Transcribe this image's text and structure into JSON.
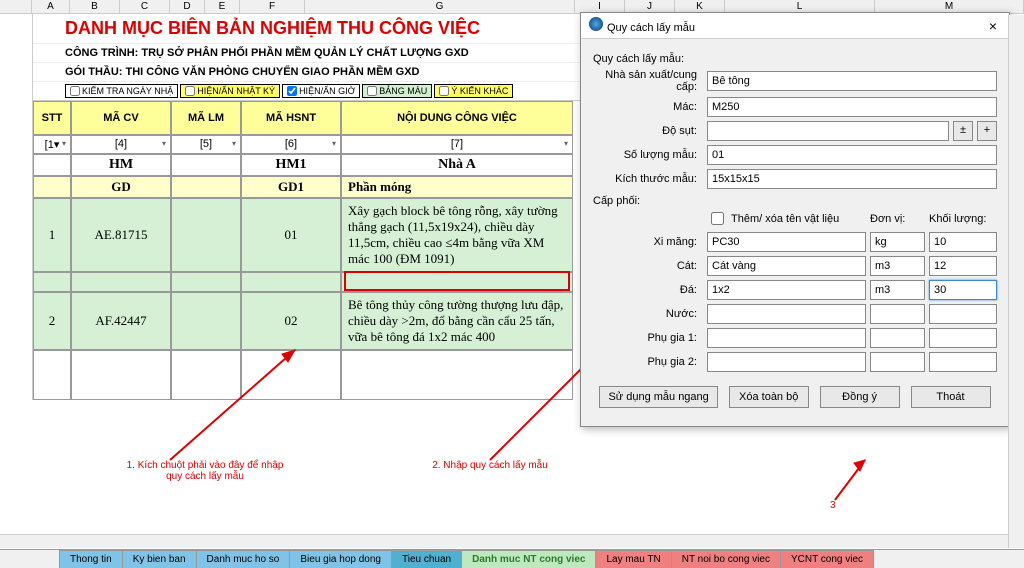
{
  "columns": [
    "A",
    "B",
    "C",
    "D",
    "E",
    "F",
    "G",
    "I",
    "J",
    "K",
    "L",
    "M"
  ],
  "title": "DANH MỤC BIÊN BẢN NGHIỆM THU CÔNG VIỆC",
  "subtitle1_label": "CÔNG TRÌNH:",
  "subtitle1_value": "TRỤ SỞ PHÂN PHỐI PHẦN MỀM QUẢN LÝ CHẤT LƯỢNG GXD",
  "subtitle2_label": "GÓI THẦU:",
  "subtitle2_value": "THI CÔNG VĂN PHÒNG CHUYỂN GIAO PHẦN MỀM GXD",
  "checks": {
    "c1": "KIỂM TRA NGÀY NHẬ",
    "c2": "HIỆN/ẨN NHẬT KÝ",
    "c3": "HIỆN/ẨN GIỜ",
    "c4": "BẢNG MÀU",
    "c5": "Ý KIẾN KHÁC"
  },
  "headers": {
    "stt": "STT",
    "macv": "MÃ CV",
    "malm": "MÃ LM",
    "mahsnt": "MÃ HSNT",
    "noidung": "NỘI DUNG CÔNG VIỆC"
  },
  "filters": [
    "[1▾",
    "[4]",
    "[5]",
    "[6]",
    "[7]"
  ],
  "row_hm": {
    "b": "HM",
    "d": "HM1",
    "e": "Nhà A"
  },
  "row_gd": {
    "b": "GD",
    "d": "GD1",
    "e": "Phần móng"
  },
  "rows": [
    {
      "stt": "1",
      "macv": "AE.81715",
      "mahsnt": "01",
      "nd": "Xây gạch block bê tông rỗng, xây tường thẳng gạch (11,5x19x24), chiều dày 11,5cm, chiều cao ≤4m bằng vữa XM mác 100 (ĐM 1091)"
    },
    {
      "stt": "2",
      "macv": "AF.42447",
      "mahsnt": "02",
      "nd": "Bê tông thủy công tường thượng lưu đập, chiều dày >2m, đổ bằng cần cẩu 25 tấn, vữa bê tông đá 1x2 mác 400"
    }
  ],
  "notes": {
    "n1": "1. Kích chuột phải vào đây để nhập quy cách lấy mẫu",
    "n2": "2. Nhập quy cách lấy mẫu",
    "n3": "3"
  },
  "tabs": [
    "Thong tin",
    "Ky bien ban",
    "Danh muc ho so",
    "Bieu gia hop dong",
    "Tieu chuan",
    "Danh muc NT cong viec",
    "Lay mau TN",
    "NT noi bo cong viec",
    "YCNT cong viec"
  ],
  "dialog": {
    "title": "Quy cách lấy mẫu",
    "section1": "Quy cách lấy mẫu:",
    "fields": {
      "nsx": {
        "label": "Nhà sản xuất/cung cấp:",
        "value": "Bê tông"
      },
      "mac": {
        "label": "Mác:",
        "value": "M250"
      },
      "dosut": {
        "label": "Độ sụt:",
        "value": ""
      },
      "soluong": {
        "label": "Số lượng mẫu:",
        "value": "01"
      },
      "kichthuoc": {
        "label": "Kích thước mẫu:",
        "value": "15x15x15"
      }
    },
    "pm_btn": "±",
    "plus_btn": "+",
    "section2": "Cấp phối:",
    "chk_themxoa": "Thêm/ xóa tên vật liệu",
    "col_donvi": "Đơn vị:",
    "col_khoiluong": "Khối lượng:",
    "mix": [
      {
        "label": "Xi măng:",
        "name": "PC30",
        "unit": "kg",
        "qty": "10"
      },
      {
        "label": "Cát:",
        "name": "Cát vàng",
        "unit": "m3",
        "qty": "12"
      },
      {
        "label": "Đá:",
        "name": "1x2",
        "unit": "m3",
        "qty": "30"
      },
      {
        "label": "Nước:",
        "name": "",
        "unit": "",
        "qty": ""
      },
      {
        "label": "Phụ gia 1:",
        "name": "",
        "unit": "",
        "qty": ""
      },
      {
        "label": "Phụ gia 2:",
        "name": "",
        "unit": "",
        "qty": ""
      }
    ],
    "buttons": {
      "b1": "Sử dụng mẫu ngang",
      "b2": "Xóa toàn bộ",
      "b3": "Đồng ý",
      "b4": "Thoát"
    }
  }
}
